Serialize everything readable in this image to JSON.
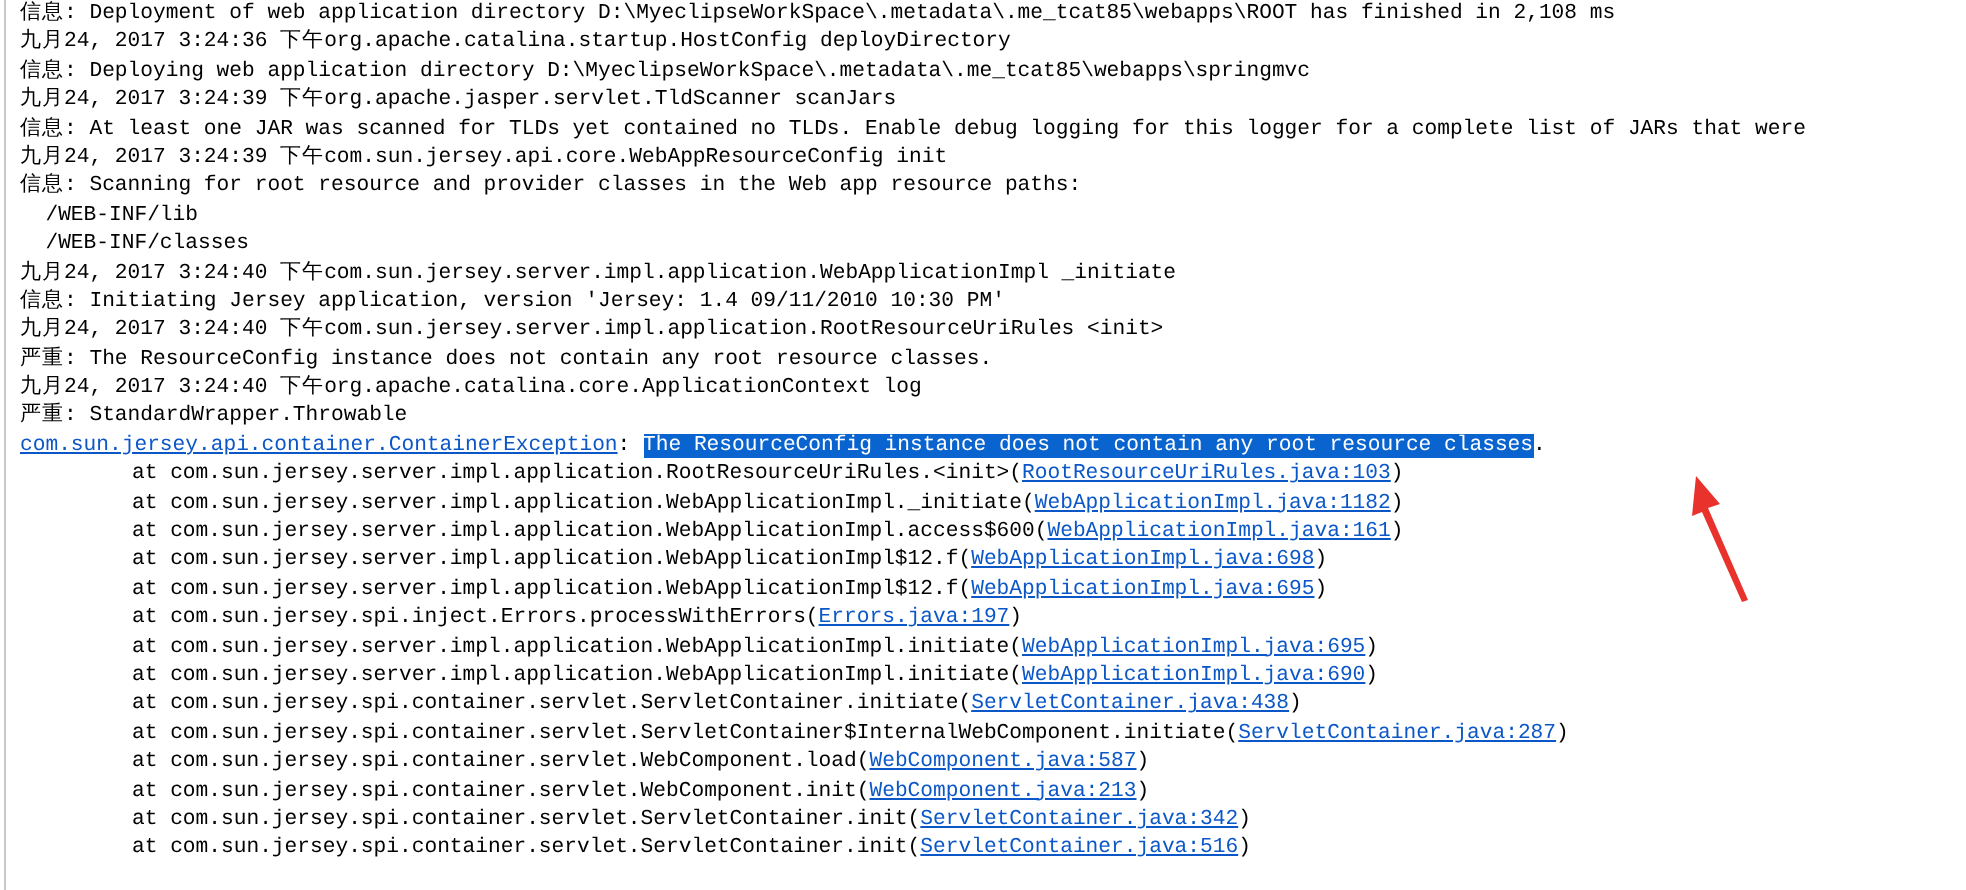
{
  "console": {
    "lines": [
      {
        "kind": "text",
        "text": "信息: Deployment of web application directory D:\\MyeclipseWorkSpace\\.metadata\\.me_tcat85\\webapps\\ROOT has finished in 2,108 ms"
      },
      {
        "kind": "text",
        "text": "九月24, 2017 3:24:36 下午org.apache.catalina.startup.HostConfig deployDirectory"
      },
      {
        "kind": "text",
        "text": "信息: Deploying web application directory D:\\MyeclipseWorkSpace\\.metadata\\.me_tcat85\\webapps\\springmvc"
      },
      {
        "kind": "text",
        "text": "九月24, 2017 3:24:39 下午org.apache.jasper.servlet.TldScanner scanJars"
      },
      {
        "kind": "text",
        "text": "信息: At least one JAR was scanned for TLDs yet contained no TLDs. Enable debug logging for this logger for a complete list of JARs that were"
      },
      {
        "kind": "text",
        "text": "九月24, 2017 3:24:39 下午com.sun.jersey.api.core.WebAppResourceConfig init"
      },
      {
        "kind": "text",
        "text": "信息: Scanning for root resource and provider classes in the Web app resource paths:"
      },
      {
        "kind": "text",
        "text": "  /WEB-INF/lib"
      },
      {
        "kind": "text",
        "text": "  /WEB-INF/classes"
      },
      {
        "kind": "text",
        "text": "九月24, 2017 3:24:40 下午com.sun.jersey.server.impl.application.WebApplicationImpl _initiate"
      },
      {
        "kind": "text",
        "text": "信息: Initiating Jersey application, version 'Jersey: 1.4 09/11/2010 10:30 PM'"
      },
      {
        "kind": "text",
        "text": "九月24, 2017 3:24:40 下午com.sun.jersey.server.impl.application.RootResourceUriRules <init>"
      },
      {
        "kind": "text",
        "text": "严重: The ResourceConfig instance does not contain any root resource classes."
      },
      {
        "kind": "text",
        "text": "九月24, 2017 3:24:40 下午org.apache.catalina.core.ApplicationContext log"
      },
      {
        "kind": "text",
        "text": "严重: StandardWrapper.Throwable"
      },
      {
        "kind": "exception",
        "link": "com.sun.jersey.api.container.ContainerException",
        "message": [
          {
            "text": ": ",
            "selected": false
          },
          {
            "text": "The ResourceConfig instance does not contain any root resource classes",
            "selected": true
          },
          {
            "text": ".",
            "selected": false
          }
        ]
      },
      {
        "kind": "frame",
        "text": "at com.sun.jersey.server.impl.application.RootResourceUriRules.<init>(",
        "link": "RootResourceUriRules.java:103",
        "end": ")"
      },
      {
        "kind": "frame",
        "text": "at com.sun.jersey.server.impl.application.WebApplicationImpl._initiate(",
        "link": "WebApplicationImpl.java:1182",
        "end": ")"
      },
      {
        "kind": "frame",
        "text": "at com.sun.jersey.server.impl.application.WebApplicationImpl.access$600(",
        "link": "WebApplicationImpl.java:161",
        "end": ")"
      },
      {
        "kind": "frame",
        "text": "at com.sun.jersey.server.impl.application.WebApplicationImpl$12.f(",
        "link": "WebApplicationImpl.java:698",
        "end": ")"
      },
      {
        "kind": "frame",
        "text": "at com.sun.jersey.server.impl.application.WebApplicationImpl$12.f(",
        "link": "WebApplicationImpl.java:695",
        "end": ")"
      },
      {
        "kind": "frame",
        "text": "at com.sun.jersey.spi.inject.Errors.processWithErrors(",
        "link": "Errors.java:197",
        "end": ")"
      },
      {
        "kind": "frame",
        "text": "at com.sun.jersey.server.impl.application.WebApplicationImpl.initiate(",
        "link": "WebApplicationImpl.java:695",
        "end": ")"
      },
      {
        "kind": "frame",
        "text": "at com.sun.jersey.server.impl.application.WebApplicationImpl.initiate(",
        "link": "WebApplicationImpl.java:690",
        "end": ")"
      },
      {
        "kind": "frame",
        "text": "at com.sun.jersey.spi.container.servlet.ServletContainer.initiate(",
        "link": "ServletContainer.java:438",
        "end": ")"
      },
      {
        "kind": "frame",
        "text": "at com.sun.jersey.spi.container.servlet.ServletContainer$InternalWebComponent.initiate(",
        "link": "ServletContainer.java:287",
        "end": ")"
      },
      {
        "kind": "frame",
        "text": "at com.sun.jersey.spi.container.servlet.WebComponent.load(",
        "link": "WebComponent.java:587",
        "end": ")"
      },
      {
        "kind": "frame",
        "text": "at com.sun.jersey.spi.container.servlet.WebComponent.init(",
        "link": "WebComponent.java:213",
        "end": ")"
      },
      {
        "kind": "frame",
        "text": "at com.sun.jersey.spi.container.servlet.ServletContainer.init(",
        "link": "ServletContainer.java:342",
        "end": ")"
      },
      {
        "kind": "frame",
        "text": "at com.sun.jersey.spi.container.servlet.ServletContainer.init(",
        "link": "ServletContainer.java:516",
        "end": ")"
      }
    ]
  }
}
